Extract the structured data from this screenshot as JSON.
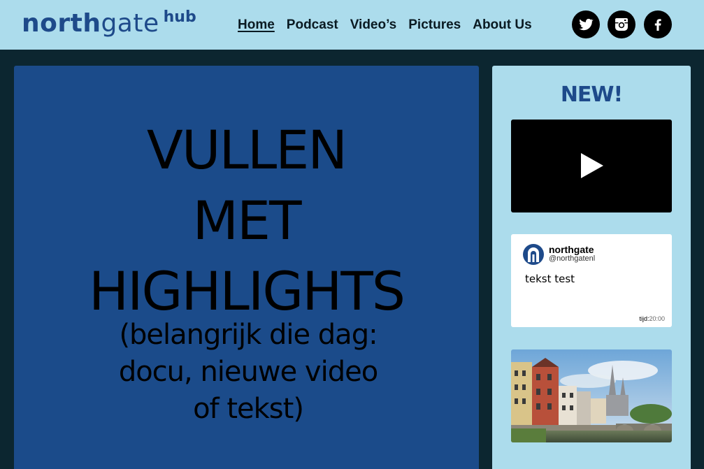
{
  "header": {
    "logo": {
      "north": "north",
      "gate": "gate",
      "hub": "hub"
    },
    "nav": [
      {
        "label": "Home",
        "active": true
      },
      {
        "label": "Podcast",
        "active": false
      },
      {
        "label": "Video’s",
        "active": false
      },
      {
        "label": "Pictures",
        "active": false
      },
      {
        "label": "About Us",
        "active": false
      }
    ],
    "social": [
      "twitter-icon",
      "instagram-icon",
      "facebook-icon"
    ]
  },
  "main": {
    "title_lines": [
      "VULLEN",
      "MET",
      "HIGHLIGHTS"
    ],
    "subtitle_lines": [
      "(belangrijk die dag:",
      "docu, nieuwe video",
      "of tekst)"
    ]
  },
  "sidebar": {
    "heading": "NEW!",
    "video": {
      "icon": "play-icon"
    },
    "tweet": {
      "name": "northgate",
      "handle": "@northgatenl",
      "text": "tekst test",
      "time_label": "tijd:",
      "time_value": "20:00"
    },
    "photo": {
      "icon": "town-photo"
    }
  },
  "colors": {
    "header_bg": "#acdcec",
    "page_bg": "#0c2630",
    "panel_blue": "#1b4b8a",
    "brand_blue": "#1e4a8a"
  }
}
